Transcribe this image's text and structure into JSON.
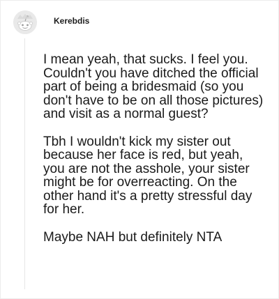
{
  "comment": {
    "author": "Kerebdis",
    "avatar_icon": "reddit-snoo-icon",
    "paragraphs": [
      "I mean yeah, that sucks. I feel you. Couldn't you have ditched the official part of being a bridesmaid (so you don't have to be on all those pictures) and visit as a normal guest?",
      "Tbh I wouldn't kick my sister out because her face is red, but yeah, you are not the asshole, your sister might be for overreacting. On the other hand it's a pretty stressful day for her.",
      "Maybe NAH but definitely NTA"
    ]
  },
  "colors": {
    "text": "#1a1a1a",
    "thread_line": "#e6e6e6",
    "avatar_bg": "#e9e9e9"
  }
}
